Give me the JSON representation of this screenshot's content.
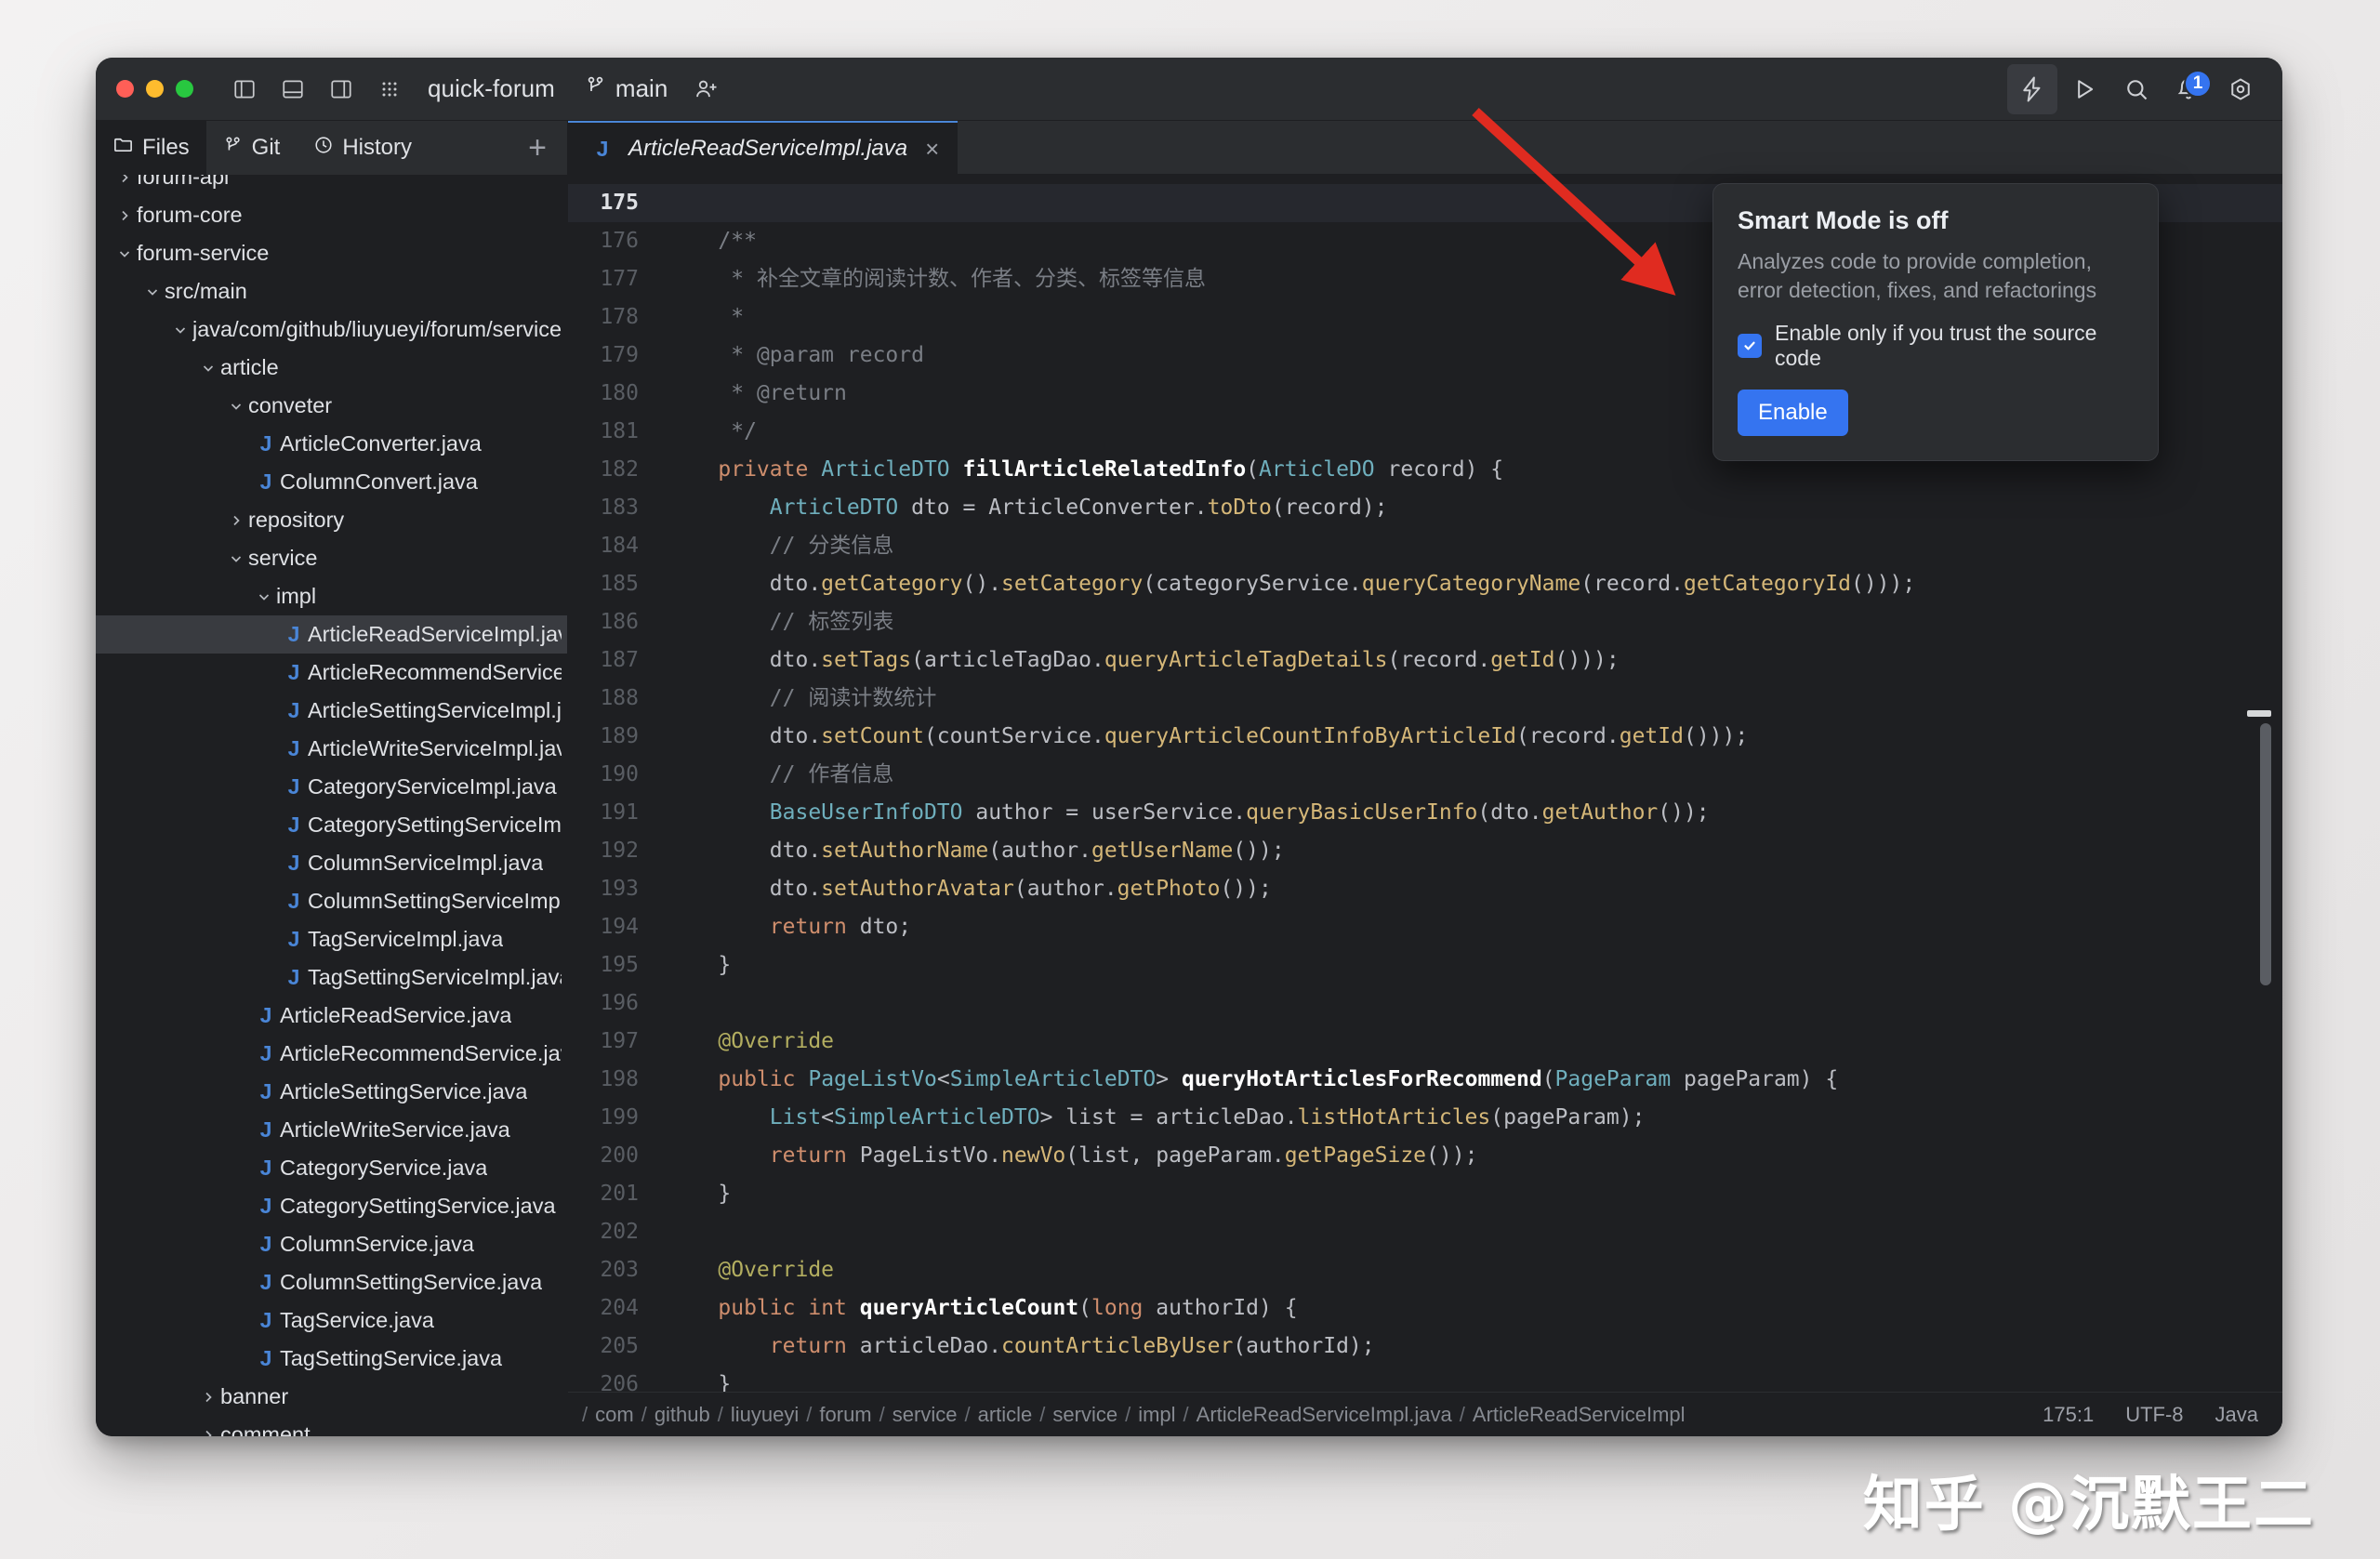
{
  "window": {
    "project_name": "quick-forum",
    "branch": "main",
    "traffic_lights": [
      "close",
      "minimize",
      "zoom"
    ],
    "left_icons": [
      "left-panel-icon",
      "bottom-panel-icon",
      "right-panel-icon",
      "grid-apps-icon"
    ],
    "right_icons": [
      "lightning-icon",
      "run-icon",
      "search-icon",
      "notifications-icon",
      "settings-icon"
    ],
    "notification_count": "1"
  },
  "sidebar": {
    "tabs": [
      {
        "label": "Files",
        "icon": "folder-icon",
        "selected": true
      },
      {
        "label": "Git",
        "icon": "git-branch-icon",
        "selected": false
      },
      {
        "label": "History",
        "icon": "clock-icon",
        "selected": false
      }
    ],
    "add_label": "+",
    "tree": [
      {
        "label": "forum-api",
        "indent": 0,
        "kind": "dir",
        "state": "collapsed",
        "partial": true
      },
      {
        "label": "forum-core",
        "indent": 0,
        "kind": "dir",
        "state": "collapsed"
      },
      {
        "label": "forum-service",
        "indent": 0,
        "kind": "dir",
        "state": "expanded"
      },
      {
        "label": "src/main",
        "indent": 1,
        "kind": "dir",
        "state": "expanded"
      },
      {
        "label": "java/com/github/liuyueyi/forum/service",
        "indent": 2,
        "kind": "dir",
        "state": "expanded"
      },
      {
        "label": "article",
        "indent": 3,
        "kind": "dir",
        "state": "expanded"
      },
      {
        "label": "conveter",
        "indent": 4,
        "kind": "dir",
        "state": "expanded"
      },
      {
        "label": "ArticleConverter.java",
        "indent": 5,
        "kind": "java"
      },
      {
        "label": "ColumnConvert.java",
        "indent": 5,
        "kind": "java"
      },
      {
        "label": "repository",
        "indent": 4,
        "kind": "dir",
        "state": "collapsed"
      },
      {
        "label": "service",
        "indent": 4,
        "kind": "dir",
        "state": "expanded"
      },
      {
        "label": "impl",
        "indent": 5,
        "kind": "dir",
        "state": "expanded"
      },
      {
        "label": "ArticleReadServiceImpl.java",
        "indent": 6,
        "kind": "java",
        "selected": true
      },
      {
        "label": "ArticleRecommendServiceImpl.java",
        "indent": 6,
        "kind": "java"
      },
      {
        "label": "ArticleSettingServiceImpl.java",
        "indent": 6,
        "kind": "java"
      },
      {
        "label": "ArticleWriteServiceImpl.java",
        "indent": 6,
        "kind": "java"
      },
      {
        "label": "CategoryServiceImpl.java",
        "indent": 6,
        "kind": "java"
      },
      {
        "label": "CategorySettingServiceImpl.java",
        "indent": 6,
        "kind": "java"
      },
      {
        "label": "ColumnServiceImpl.java",
        "indent": 6,
        "kind": "java"
      },
      {
        "label": "ColumnSettingServiceImpl.java",
        "indent": 6,
        "kind": "java"
      },
      {
        "label": "TagServiceImpl.java",
        "indent": 6,
        "kind": "java"
      },
      {
        "label": "TagSettingServiceImpl.java",
        "indent": 6,
        "kind": "java"
      },
      {
        "label": "ArticleReadService.java",
        "indent": 5,
        "kind": "java"
      },
      {
        "label": "ArticleRecommendService.java",
        "indent": 5,
        "kind": "java"
      },
      {
        "label": "ArticleSettingService.java",
        "indent": 5,
        "kind": "java"
      },
      {
        "label": "ArticleWriteService.java",
        "indent": 5,
        "kind": "java"
      },
      {
        "label": "CategoryService.java",
        "indent": 5,
        "kind": "java"
      },
      {
        "label": "CategorySettingService.java",
        "indent": 5,
        "kind": "java"
      },
      {
        "label": "ColumnService.java",
        "indent": 5,
        "kind": "java"
      },
      {
        "label": "ColumnSettingService.java",
        "indent": 5,
        "kind": "java"
      },
      {
        "label": "TagService.java",
        "indent": 5,
        "kind": "java"
      },
      {
        "label": "TagSettingService.java",
        "indent": 5,
        "kind": "java"
      },
      {
        "label": "banner",
        "indent": 3,
        "kind": "dir",
        "state": "collapsed"
      },
      {
        "label": "comment",
        "indent": 3,
        "kind": "dir",
        "state": "collapsed"
      }
    ]
  },
  "editor": {
    "tab": {
      "label": "ArticleReadServiceImpl.java",
      "icon": "java-file-icon",
      "close": "×"
    },
    "current_line": 175,
    "first_line": 175,
    "lines": [
      {
        "n": 175,
        "tokens": []
      },
      {
        "n": 176,
        "tokens": [
          {
            "t": "    ",
            "c": "pun"
          },
          {
            "t": "/**",
            "c": "cmt"
          }
        ]
      },
      {
        "n": 177,
        "tokens": [
          {
            "t": "     ",
            "c": "pun"
          },
          {
            "t": "* 补全文章的阅读计数、作者、分类、标签等信息",
            "c": "cmt"
          }
        ]
      },
      {
        "n": 178,
        "tokens": [
          {
            "t": "     ",
            "c": "pun"
          },
          {
            "t": "*",
            "c": "cmt"
          }
        ]
      },
      {
        "n": 179,
        "tokens": [
          {
            "t": "     ",
            "c": "pun"
          },
          {
            "t": "* @param record",
            "c": "cmt"
          }
        ]
      },
      {
        "n": 180,
        "tokens": [
          {
            "t": "     ",
            "c": "pun"
          },
          {
            "t": "* @return",
            "c": "cmt"
          }
        ]
      },
      {
        "n": 181,
        "tokens": [
          {
            "t": "     ",
            "c": "pun"
          },
          {
            "t": "*/",
            "c": "cmt"
          }
        ]
      },
      {
        "n": 182,
        "tokens": [
          {
            "t": "    ",
            "c": "pun"
          },
          {
            "t": "private",
            "c": "kw"
          },
          {
            "t": " ",
            "c": "pun"
          },
          {
            "t": "ArticleDTO",
            "c": "typ"
          },
          {
            "t": " ",
            "c": "pun"
          },
          {
            "t": "fillArticleRelatedInfo",
            "c": "fdecl"
          },
          {
            "t": "(",
            "c": "pun"
          },
          {
            "t": "ArticleDO",
            "c": "typ"
          },
          {
            "t": " record) {",
            "c": "pun"
          }
        ]
      },
      {
        "n": 183,
        "tokens": [
          {
            "t": "        ",
            "c": "pun"
          },
          {
            "t": "ArticleDTO",
            "c": "typ"
          },
          {
            "t": " dto = ",
            "c": "pun"
          },
          {
            "t": "ArticleConverter",
            "c": "pun"
          },
          {
            "t": ".",
            "c": "pun"
          },
          {
            "t": "toDto",
            "c": "mth"
          },
          {
            "t": "(record);",
            "c": "pun"
          }
        ]
      },
      {
        "n": 184,
        "tokens": [
          {
            "t": "        ",
            "c": "pun"
          },
          {
            "t": "// 分类信息",
            "c": "cmt"
          }
        ]
      },
      {
        "n": 185,
        "tokens": [
          {
            "t": "        ",
            "c": "pun"
          },
          {
            "t": "dto.",
            "c": "pun"
          },
          {
            "t": "getCategory",
            "c": "mth"
          },
          {
            "t": "().",
            "c": "pun"
          },
          {
            "t": "setCategory",
            "c": "mth"
          },
          {
            "t": "(categoryService.",
            "c": "pun"
          },
          {
            "t": "queryCategoryName",
            "c": "mth"
          },
          {
            "t": "(record.",
            "c": "pun"
          },
          {
            "t": "getCategoryId",
            "c": "mth"
          },
          {
            "t": "()));",
            "c": "pun"
          }
        ]
      },
      {
        "n": 186,
        "tokens": [
          {
            "t": "        ",
            "c": "pun"
          },
          {
            "t": "// 标签列表",
            "c": "cmt"
          }
        ]
      },
      {
        "n": 187,
        "tokens": [
          {
            "t": "        ",
            "c": "pun"
          },
          {
            "t": "dto.",
            "c": "pun"
          },
          {
            "t": "setTags",
            "c": "mth"
          },
          {
            "t": "(articleTagDao.",
            "c": "pun"
          },
          {
            "t": "queryArticleTagDetails",
            "c": "mth"
          },
          {
            "t": "(record.",
            "c": "pun"
          },
          {
            "t": "getId",
            "c": "mth"
          },
          {
            "t": "()));",
            "c": "pun"
          }
        ]
      },
      {
        "n": 188,
        "tokens": [
          {
            "t": "        ",
            "c": "pun"
          },
          {
            "t": "// 阅读计数统计",
            "c": "cmt"
          }
        ]
      },
      {
        "n": 189,
        "tokens": [
          {
            "t": "        ",
            "c": "pun"
          },
          {
            "t": "dto.",
            "c": "pun"
          },
          {
            "t": "setCount",
            "c": "mth"
          },
          {
            "t": "(countService.",
            "c": "pun"
          },
          {
            "t": "queryArticleCountInfoByArticleId",
            "c": "mth"
          },
          {
            "t": "(record.",
            "c": "pun"
          },
          {
            "t": "getId",
            "c": "mth"
          },
          {
            "t": "()));",
            "c": "pun"
          }
        ]
      },
      {
        "n": 190,
        "tokens": [
          {
            "t": "        ",
            "c": "pun"
          },
          {
            "t": "// 作者信息",
            "c": "cmt"
          }
        ]
      },
      {
        "n": 191,
        "tokens": [
          {
            "t": "        ",
            "c": "pun"
          },
          {
            "t": "BaseUserInfoDTO",
            "c": "typ"
          },
          {
            "t": " author = userService.",
            "c": "pun"
          },
          {
            "t": "queryBasicUserInfo",
            "c": "mth"
          },
          {
            "t": "(dto.",
            "c": "pun"
          },
          {
            "t": "getAuthor",
            "c": "mth"
          },
          {
            "t": "());",
            "c": "pun"
          }
        ]
      },
      {
        "n": 192,
        "tokens": [
          {
            "t": "        ",
            "c": "pun"
          },
          {
            "t": "dto.",
            "c": "pun"
          },
          {
            "t": "setAuthorName",
            "c": "mth"
          },
          {
            "t": "(author.",
            "c": "pun"
          },
          {
            "t": "getUserName",
            "c": "mth"
          },
          {
            "t": "());",
            "c": "pun"
          }
        ]
      },
      {
        "n": 193,
        "tokens": [
          {
            "t": "        ",
            "c": "pun"
          },
          {
            "t": "dto.",
            "c": "pun"
          },
          {
            "t": "setAuthorAvatar",
            "c": "mth"
          },
          {
            "t": "(author.",
            "c": "pun"
          },
          {
            "t": "getPhoto",
            "c": "mth"
          },
          {
            "t": "());",
            "c": "pun"
          }
        ]
      },
      {
        "n": 194,
        "tokens": [
          {
            "t": "        ",
            "c": "pun"
          },
          {
            "t": "return",
            "c": "kw"
          },
          {
            "t": " dto;",
            "c": "pun"
          }
        ]
      },
      {
        "n": 195,
        "tokens": [
          {
            "t": "    }",
            "c": "pun"
          }
        ]
      },
      {
        "n": 196,
        "tokens": []
      },
      {
        "n": 197,
        "tokens": [
          {
            "t": "    ",
            "c": "pun"
          },
          {
            "t": "@Override",
            "c": "ann"
          }
        ]
      },
      {
        "n": 198,
        "tokens": [
          {
            "t": "    ",
            "c": "pun"
          },
          {
            "t": "public",
            "c": "kw"
          },
          {
            "t": " ",
            "c": "pun"
          },
          {
            "t": "PageListVo",
            "c": "typ"
          },
          {
            "t": "<",
            "c": "pun"
          },
          {
            "t": "SimpleArticleDTO",
            "c": "typ"
          },
          {
            "t": "> ",
            "c": "pun"
          },
          {
            "t": "queryHotArticlesForRecommend",
            "c": "fdecl"
          },
          {
            "t": "(",
            "c": "pun"
          },
          {
            "t": "PageParam",
            "c": "typ"
          },
          {
            "t": " pageParam) {",
            "c": "pun"
          }
        ]
      },
      {
        "n": 199,
        "tokens": [
          {
            "t": "        ",
            "c": "pun"
          },
          {
            "t": "List",
            "c": "typ"
          },
          {
            "t": "<",
            "c": "pun"
          },
          {
            "t": "SimpleArticleDTO",
            "c": "typ"
          },
          {
            "t": "> list = articleDao.",
            "c": "pun"
          },
          {
            "t": "listHotArticles",
            "c": "mth"
          },
          {
            "t": "(pageParam);",
            "c": "pun"
          }
        ]
      },
      {
        "n": 200,
        "tokens": [
          {
            "t": "        ",
            "c": "pun"
          },
          {
            "t": "return",
            "c": "kw"
          },
          {
            "t": " PageListVo.",
            "c": "pun"
          },
          {
            "t": "newVo",
            "c": "mth"
          },
          {
            "t": "(list, pageParam.",
            "c": "pun"
          },
          {
            "t": "getPageSize",
            "c": "mth"
          },
          {
            "t": "());",
            "c": "pun"
          }
        ]
      },
      {
        "n": 201,
        "tokens": [
          {
            "t": "    }",
            "c": "pun"
          }
        ]
      },
      {
        "n": 202,
        "tokens": []
      },
      {
        "n": 203,
        "tokens": [
          {
            "t": "    ",
            "c": "pun"
          },
          {
            "t": "@Override",
            "c": "ann"
          }
        ]
      },
      {
        "n": 204,
        "tokens": [
          {
            "t": "    ",
            "c": "pun"
          },
          {
            "t": "public",
            "c": "kw"
          },
          {
            "t": " ",
            "c": "pun"
          },
          {
            "t": "int",
            "c": "kw"
          },
          {
            "t": " ",
            "c": "pun"
          },
          {
            "t": "queryArticleCount",
            "c": "fdecl"
          },
          {
            "t": "(",
            "c": "pun"
          },
          {
            "t": "long",
            "c": "kw"
          },
          {
            "t": " authorId) {",
            "c": "pun"
          }
        ]
      },
      {
        "n": 205,
        "tokens": [
          {
            "t": "        ",
            "c": "pun"
          },
          {
            "t": "return",
            "c": "kw"
          },
          {
            "t": " articleDao.",
            "c": "pun"
          },
          {
            "t": "countArticleByUser",
            "c": "mth"
          },
          {
            "t": "(authorId);",
            "c": "pun"
          }
        ]
      },
      {
        "n": 206,
        "tokens": [
          {
            "t": "    }",
            "c": "pun"
          }
        ]
      }
    ]
  },
  "statusbar": {
    "breadcrumbs": [
      "com",
      "github",
      "liuyueyi",
      "forum",
      "service",
      "article",
      "service",
      "impl",
      "ArticleReadServiceImpl.java",
      "ArticleReadServiceImpl"
    ],
    "separator": "/",
    "caret_position": "175:1",
    "encoding": "UTF-8",
    "language": "Java"
  },
  "popup": {
    "title": "Smart Mode is off",
    "description": "Analyzes code to provide completion, error detection, fixes, and refactorings",
    "checkbox_label": "Enable only if you trust the source code",
    "checkbox_checked": true,
    "enable_label": "Enable",
    "accent_color": "#3574f0"
  },
  "annotation": {
    "arrow_color": "#e02b20"
  },
  "watermark": {
    "text": "知乎 @沉默王二"
  }
}
